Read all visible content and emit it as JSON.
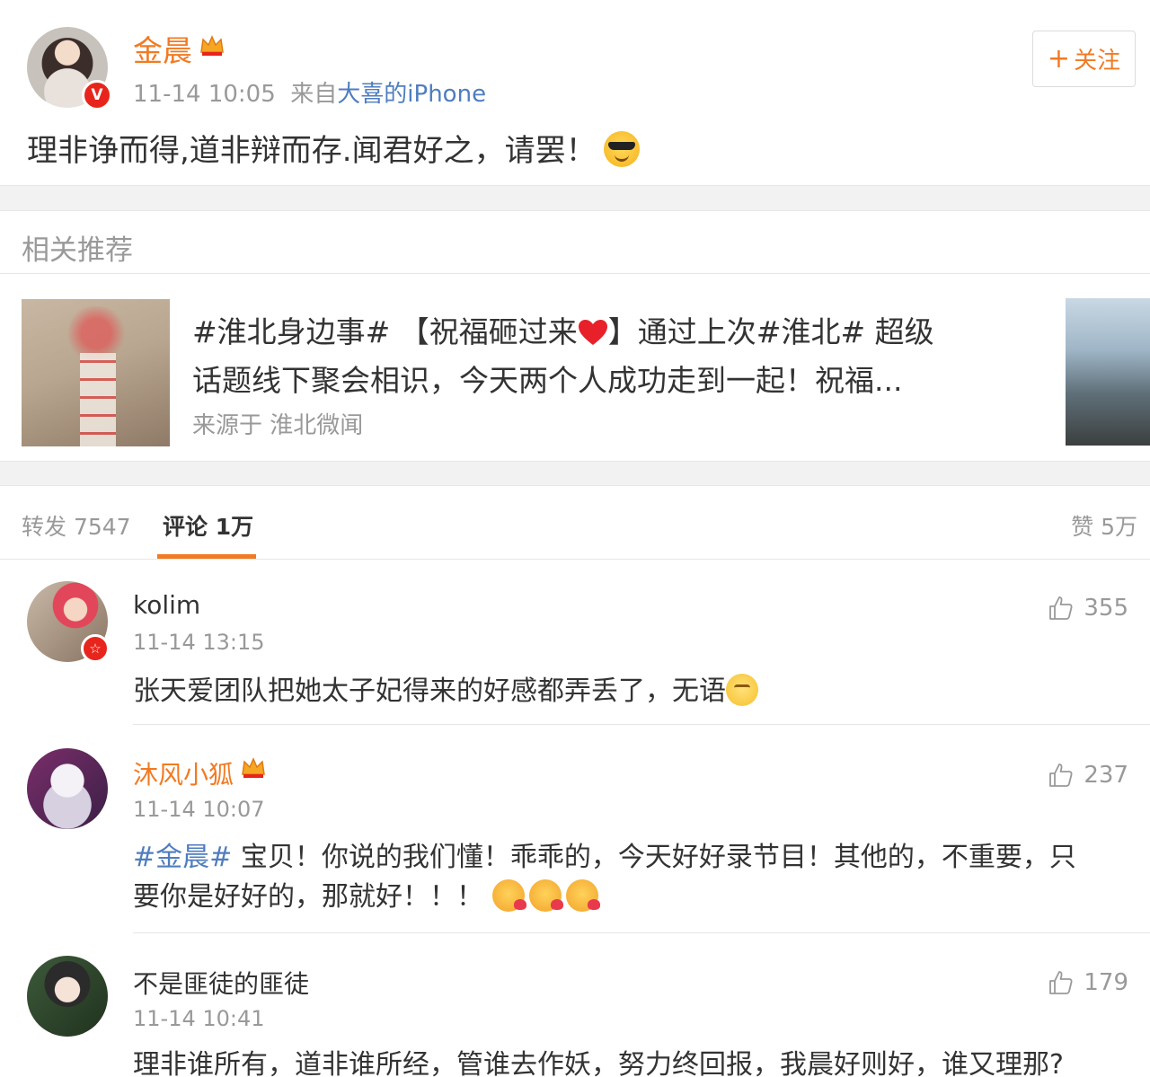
{
  "post": {
    "author": "金晨",
    "time": "11-14 10:05",
    "from_prefix": "来自",
    "source": "大喜的iPhone",
    "follow_label": "关注",
    "text": "理非诤而得,道非辩而存.闻君好之，请罢！"
  },
  "related": {
    "title": "相关推荐",
    "line1_a": "#淮北身边事# 【祝福砸过来",
    "line1_b": "】通过上次#淮北# 超级",
    "line2": "话题线下聚会相识，今天两个人成功走到一起！祝福...",
    "source_label": "来源于 淮北微闻"
  },
  "tabs": {
    "repost": "转发 7547",
    "comments": "评论 1万",
    "likes": "赞 5万"
  },
  "comments": [
    {
      "user": "kolim",
      "time": "11-14 13:15",
      "likes": "355",
      "text": "张天爱团队把她太子妃得来的好感都弄丢了，无语"
    },
    {
      "user": "沐风小狐",
      "time": "11-14 10:07",
      "likes": "237",
      "hashtag": "#金晨#",
      "text_line1": " 宝贝！你说的我们懂！乖乖的，今天好好录节目！其他的，不重要，只",
      "text_line2": "要你是好好的，那就好！！！"
    },
    {
      "user": "不是匪徒的匪徒",
      "time": "11-14 10:41",
      "likes": "179",
      "text": "理非谁所有，道非谁所经，管谁去作妖，努力终回报，我晨好则好，谁又理那?"
    }
  ],
  "colors": {
    "accent": "#f27a22",
    "link": "#4f7dbf",
    "verified": "#e8251c"
  }
}
